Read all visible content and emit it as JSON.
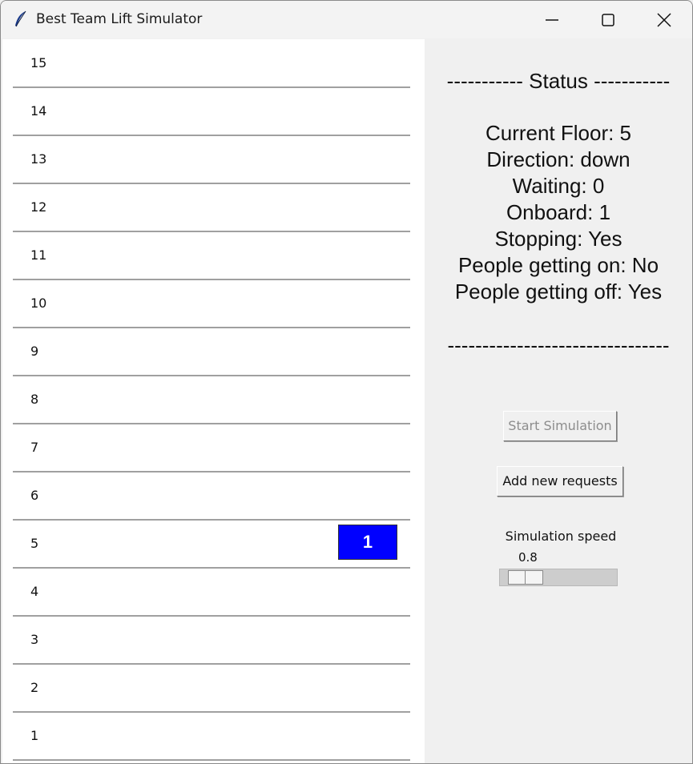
{
  "window": {
    "title": "Best Team Lift Simulator",
    "icon": "feather-icon"
  },
  "floors": [
    {
      "label": "15"
    },
    {
      "label": "14"
    },
    {
      "label": "13"
    },
    {
      "label": "12"
    },
    {
      "label": "11"
    },
    {
      "label": "10"
    },
    {
      "label": "9"
    },
    {
      "label": "8"
    },
    {
      "label": "7"
    },
    {
      "label": "6"
    },
    {
      "label": "5"
    },
    {
      "label": "4"
    },
    {
      "label": "3"
    },
    {
      "label": "2"
    },
    {
      "label": "1"
    }
  ],
  "lift": {
    "count_label": "1",
    "floor": 5,
    "color": "#0000ff"
  },
  "status": {
    "header": "----------- Status -----------",
    "current_floor": "Current Floor: 5",
    "direction": "Direction: down",
    "waiting": "Waiting: 0",
    "onboard": "Onboard: 1",
    "stopping": "Stopping: Yes",
    "getting_on": "People getting on: No",
    "getting_off": "People getting off: Yes",
    "footer": "--------------------------------"
  },
  "controls": {
    "start_label": "Start Simulation",
    "add_label": "Add new requests",
    "speed_label": "Simulation speed",
    "speed_value": "0.8"
  }
}
